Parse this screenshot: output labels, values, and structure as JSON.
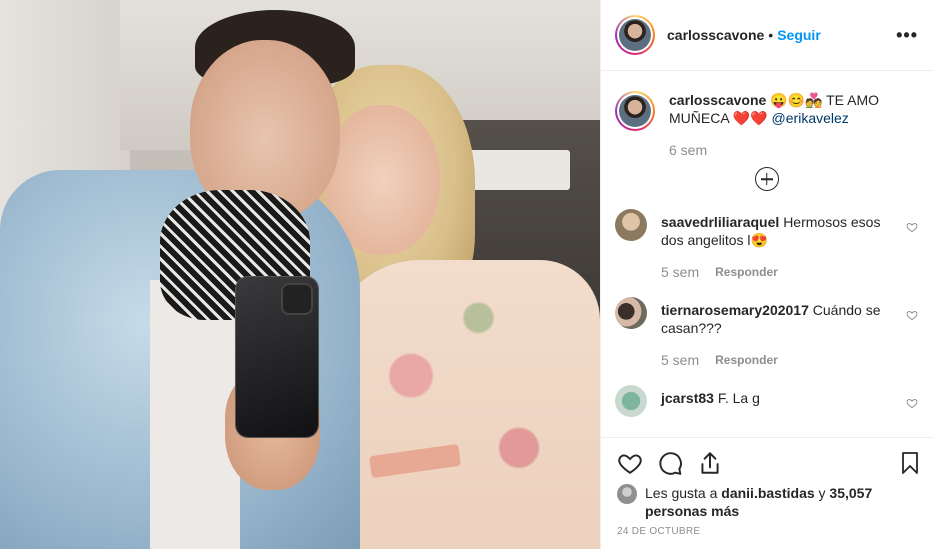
{
  "post": {
    "username": "carlosscavone",
    "separator": "•",
    "follow_label": "Seguir",
    "more_icon": "more-options-icon",
    "more_label": "•••"
  },
  "caption": {
    "username": "carlosscavone",
    "text": "😛😊💑 TE AMO MUÑECA ❤️❤️",
    "mention": "@erikavelez",
    "age": "6 sem",
    "load_more_icon": "plus-circle-icon"
  },
  "comments": [
    {
      "username": "saavedrliliaraquel",
      "text": "Hermosos esos dos angelitos l😍",
      "age": "5 sem",
      "reply_label": "Responder"
    },
    {
      "username": "tiernarosemary202017",
      "text": "Cuándo se casan???",
      "age": "5 sem",
      "reply_label": "Responder"
    },
    {
      "username": "jcarst83",
      "text": "F. La g",
      "age": "",
      "reply_label": ""
    }
  ],
  "actions": {
    "like_icon": "heart-icon",
    "comment_icon": "comment-icon",
    "share_icon": "share-icon",
    "save_icon": "bookmark-icon"
  },
  "likes": {
    "prefix": "Les gusta a ",
    "user": "danii.bastidas",
    "joiner": " y ",
    "others": "35,057 personas más"
  },
  "date": "24 DE OCTUBRE"
}
